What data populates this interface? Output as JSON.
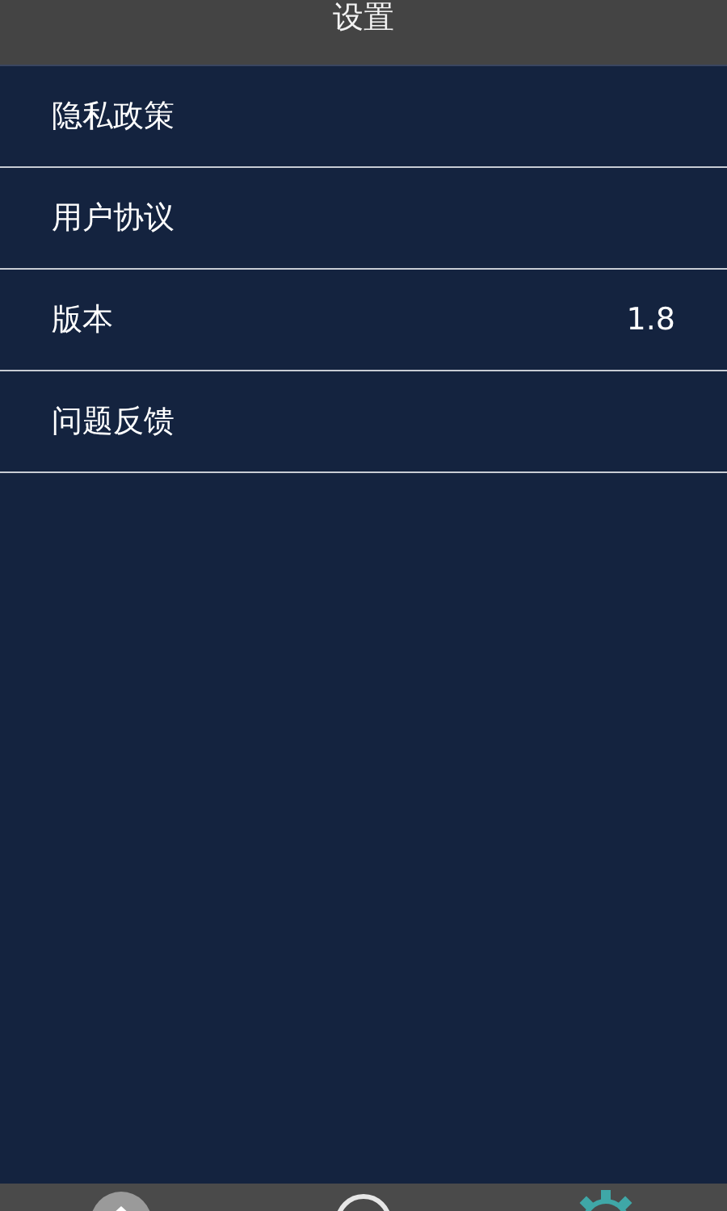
{
  "header": {
    "title": "设置"
  },
  "settings": [
    {
      "label": "隐私政策"
    },
    {
      "label": "用户协议"
    },
    {
      "label": "版本",
      "value": "1.8"
    },
    {
      "label": "问题反馈"
    }
  ],
  "tab_bar": [
    {
      "kind": "home",
      "selected": false
    },
    {
      "kind": "circle",
      "selected": false
    },
    {
      "kind": "gear",
      "selected": true
    }
  ]
}
